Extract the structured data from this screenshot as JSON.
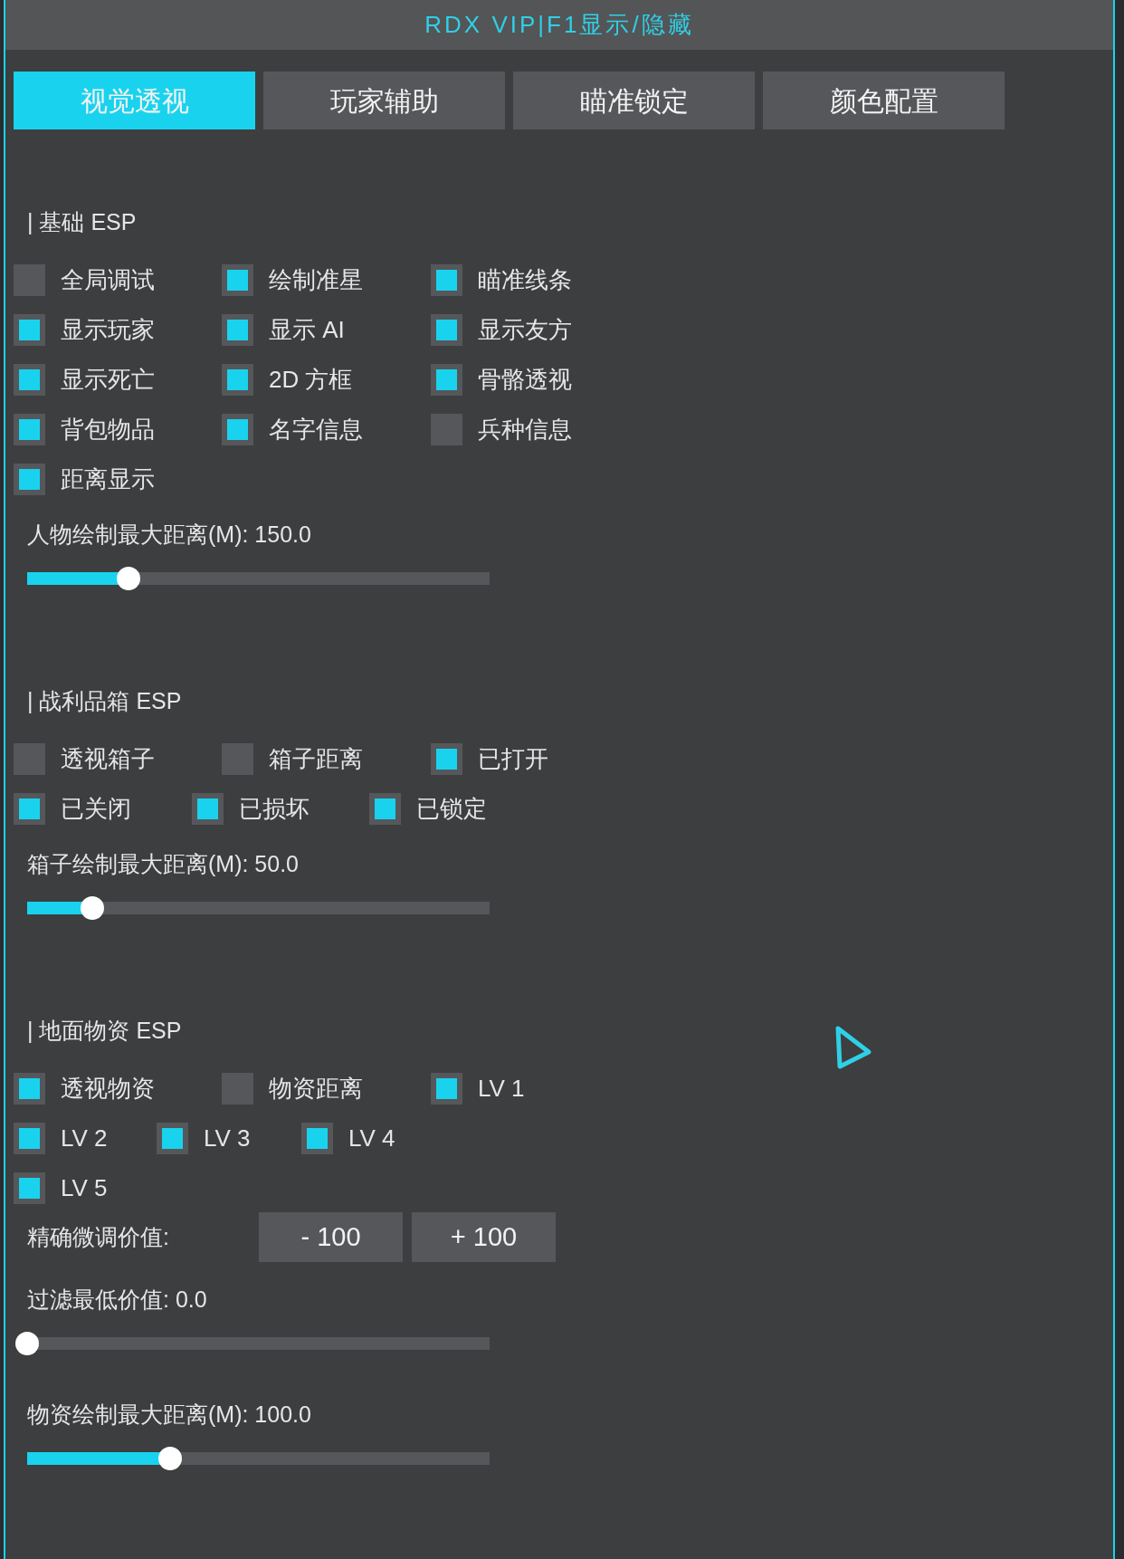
{
  "window": {
    "title": "RDX VIP|F1显示/隐藏"
  },
  "tabs": [
    {
      "label": "视觉透视",
      "selected": true
    },
    {
      "label": "玩家辅助",
      "selected": false
    },
    {
      "label": "瞄准锁定",
      "selected": false
    },
    {
      "label": "颜色配置",
      "selected": false
    }
  ],
  "sections": [
    {
      "header": "| 基础 ESP",
      "controls": [
        {
          "kind": "checkboxes",
          "items": [
            {
              "label": "全局调试",
              "checked": false
            },
            {
              "label": "绘制准星",
              "checked": true
            },
            {
              "label": "瞄准线条",
              "checked": true
            }
          ]
        },
        {
          "kind": "checkboxes",
          "items": [
            {
              "label": "显示玩家",
              "checked": true
            },
            {
              "label": "显示 AI",
              "checked": true
            },
            {
              "label": "显示友方",
              "checked": true
            }
          ]
        },
        {
          "kind": "checkboxes",
          "items": [
            {
              "label": "显示死亡",
              "checked": true
            },
            {
              "label": "2D 方框",
              "checked": true
            },
            {
              "label": "骨骼透视",
              "checked": true
            }
          ]
        },
        {
          "kind": "checkboxes",
          "items": [
            {
              "label": "背包物品",
              "checked": true
            },
            {
              "label": "名字信息",
              "checked": true
            },
            {
              "label": "兵种信息",
              "checked": false
            }
          ]
        },
        {
          "kind": "checkboxes",
          "items": [
            {
              "label": "距离显示",
              "checked": true
            }
          ]
        },
        {
          "kind": "slider",
          "label": "人物绘制最大距离(M): 150.0",
          "level": 0.22
        }
      ]
    },
    {
      "header": "| 战利品箱 ESP",
      "controls": [
        {
          "kind": "checkboxes",
          "items": [
            {
              "label": "透视箱子",
              "checked": false
            },
            {
              "label": "箱子距离",
              "checked": false
            },
            {
              "label": "已打开",
              "checked": true
            }
          ]
        },
        {
          "kind": "checkboxes",
          "items": [
            {
              "label": "已关闭",
              "checked": true
            },
            {
              "label": "已损坏",
              "checked": true
            },
            {
              "label": "已锁定",
              "checked": true
            }
          ]
        },
        {
          "kind": "slider",
          "label": "箱子绘制最大距离(M): 50.0",
          "level": 0.14
        }
      ]
    },
    {
      "header": "| 地面物资 ESP",
      "controls": [
        {
          "kind": "checkboxes",
          "items": [
            {
              "label": "透视物资",
              "checked": true
            },
            {
              "label": "物资距离",
              "checked": false
            },
            {
              "label": "LV 1",
              "checked": true
            }
          ]
        },
        {
          "kind": "checkboxes",
          "items": [
            {
              "label": "LV 2",
              "checked": true
            },
            {
              "label": "LV 3",
              "checked": true
            },
            {
              "label": "LV 4",
              "checked": true
            }
          ]
        },
        {
          "kind": "checkboxes",
          "items": [
            {
              "label": "LV 5",
              "checked": true
            }
          ]
        },
        {
          "kind": "buttons",
          "label": "精确微调价值:",
          "buttons": [
            "- 100",
            "+ 100"
          ]
        },
        {
          "kind": "slider",
          "label": "过滤最低价值: 0.0",
          "level": 0.0
        },
        {
          "kind": "slider",
          "label": "物资绘制最大距离(M): 100.0",
          "level": 0.31
        }
      ]
    }
  ]
}
